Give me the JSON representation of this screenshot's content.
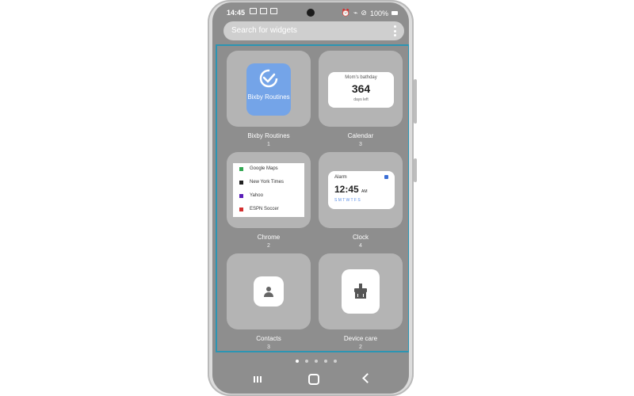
{
  "status": {
    "time": "14:45",
    "battery": "100%"
  },
  "search": {
    "placeholder": "Search for widgets"
  },
  "widgets": [
    {
      "name": "Bixby Routines",
      "count": "1",
      "preview_text": "Bixby Routines"
    },
    {
      "name": "Calendar",
      "count": "3",
      "preview_title": "Mom's bathday",
      "preview_value": "364",
      "preview_sub": "days left"
    },
    {
      "name": "Chrome",
      "count": "2",
      "bookmarks": [
        "Google Maps",
        "New York Times",
        "Yahoo",
        "ESPN Soccer"
      ]
    },
    {
      "name": "Clock",
      "count": "4",
      "preview_title": "Alarm",
      "preview_time": "12:45",
      "preview_ampm": "AM",
      "preview_days": "S M T W T F S"
    },
    {
      "name": "Contacts",
      "count": "3"
    },
    {
      "name": "Device care",
      "count": "2"
    }
  ],
  "pager": {
    "pages": 5,
    "active_index": 0
  },
  "colors": {
    "screen_bg": "#8e8e8e",
    "tile_bg": "#b4b4b4",
    "selection_border": "#2c95b3",
    "bixby_blue": "#74a4e8"
  },
  "icons": {
    "bixby": "check-circle-icon",
    "contacts": "person-icon",
    "device_care": "broom-icon",
    "nav": [
      "recent-apps-icon",
      "home-icon",
      "back-icon"
    ]
  }
}
